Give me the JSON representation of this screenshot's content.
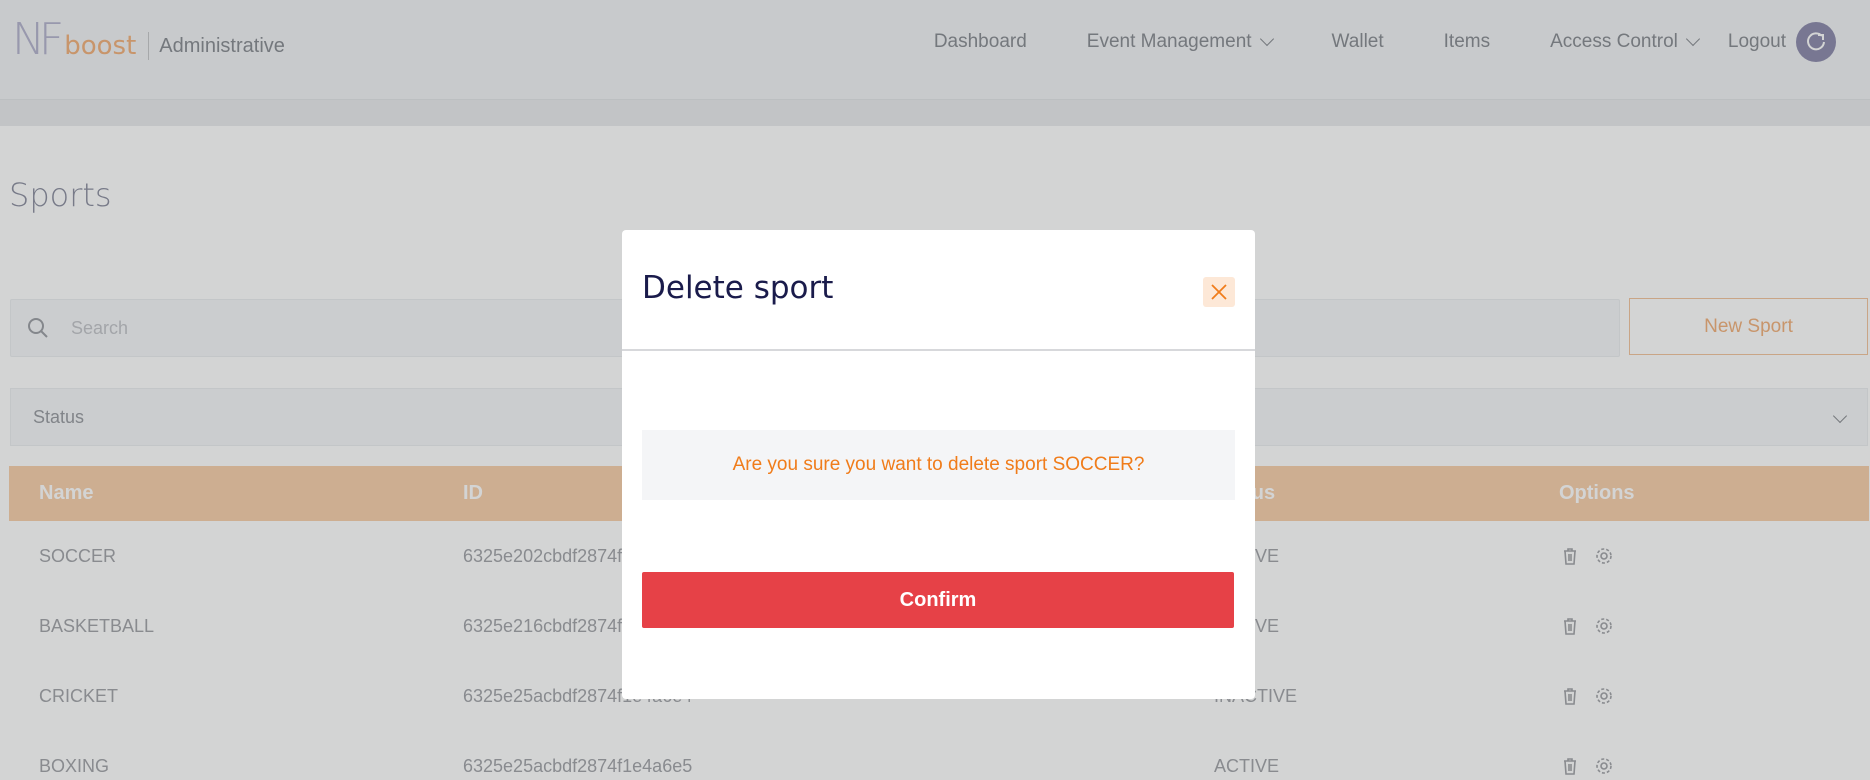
{
  "brand": {
    "logo_main": "NF",
    "logo_sub": "boost",
    "section": "Administrative"
  },
  "nav": {
    "items": [
      "Dashboard",
      "Event Management",
      "Wallet",
      "Items",
      "Access Control"
    ],
    "logout": "Logout"
  },
  "page": {
    "title": "Sports",
    "search_placeholder": "Search",
    "new_button": "New Sport",
    "status_label": "Status"
  },
  "table": {
    "headers": [
      "Name",
      "ID",
      "Status",
      "Options"
    ],
    "rows": [
      {
        "name": "SOCCER",
        "id": "6325e202cbdf2874f1e4a6e1",
        "status": "ACTIVE"
      },
      {
        "name": "BASKETBALL",
        "id": "6325e216cbdf2874f1e4a6e2",
        "status": "ACTIVE"
      },
      {
        "name": "CRICKET",
        "id": "6325e25acbdf2874f1e4a6e4",
        "status": "INACTIVE"
      },
      {
        "name": "BOXING",
        "id": "6325e25acbdf2874f1e4a6e5",
        "status": "ACTIVE"
      }
    ]
  },
  "modal": {
    "title": "Delete sport",
    "message": "Are you sure you want to delete sport SOCCER?",
    "confirm": "Confirm"
  },
  "colors": {
    "accent": "#f07c1a",
    "danger": "#e64147",
    "header_row": "#f8d0ad",
    "title_navy": "#1a1b4b"
  },
  "icons": [
    "search-icon",
    "chevron-down-icon",
    "refresh-avatar-icon",
    "trash-icon",
    "gear-icon",
    "close-icon"
  ]
}
